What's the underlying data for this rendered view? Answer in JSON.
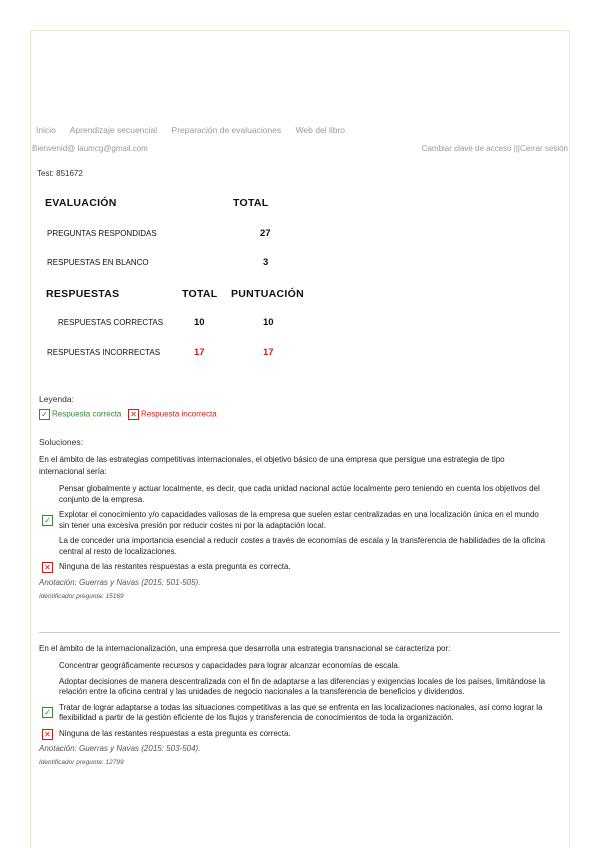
{
  "nav": {
    "items": [
      "Inicio",
      "Aprendizaje secuencial",
      "Preparación de evaluaciones",
      "Web del libro"
    ]
  },
  "header": {
    "welcome": "Bienvenid@ laumcg@gmail.com",
    "change_password": "Cambiar clave de acceso",
    "separator": "|||",
    "logout": "Cerrar sesión"
  },
  "test": {
    "label": "Test: 851672"
  },
  "results": {
    "evaluacion_heading": "EVALUACIÓN",
    "total_heading": "TOTAL",
    "answered_label": "PREGUNTAS RESPONDIDAS",
    "answered_value": "27",
    "blank_label": "RESPUESTAS EN BLANCO",
    "blank_value": "3",
    "respuestas_heading": "RESPUESTAS",
    "total_col": "TOTAL",
    "score_col": "PUNTUACIÓN",
    "correct_label": "RESPUESTAS CORRECTAS",
    "correct_total": "10",
    "correct_score": "10",
    "incorrect_label": "RESPUESTAS INCORRECTAS",
    "incorrect_total": "17",
    "incorrect_score": "17"
  },
  "legend": {
    "title": "Leyenda:",
    "correct": "Respuesta correcta",
    "incorrect": "Respuesta incorrecta"
  },
  "solutions": {
    "title": "Soluciones:",
    "questions": [
      {
        "stem": "En el ámbito de las estrategias competitivas internacionales, el objetivo básico de una empresa que persigue una estrategia de tipo internacional sería:",
        "options": [
          "Pensar globalmente y actuar localmente, es decir, que cada unidad nacional actúe localmente pero teniendo en cuenta los objetivos del conjunto de la empresa.",
          "Explotar el conocimiento y/o capacidades valiosas de la empresa que suelen estar centralizadas en una localización única en el mundo sin tener una excesiva presión por reducir costes ni por la adaptación local.",
          "La de conceder una importancia esencial a reducir costes a través de economías de escala y la transferencia de habilidades de la oficina central al resto de localizaciones.",
          "Ninguna de las restantes respuestas a esta pregunta es correcta."
        ],
        "annotation": "Anotación: Guerras y Navas (2015: 501-505).",
        "question_id": "Identificador pregunta: 15169"
      },
      {
        "stem": "En el ámbito de la internacionalización, una empresa que desarrolla una estrategia transnacional se caracteriza por:",
        "options": [
          "Concentrar geográficamente recursos y capacidades para lograr alcanzar economías de escala.",
          "Adoptar decisiones de manera descentralizada con el fin de adaptarse a las diferencias y exigencias locales de los países, limitándose la relación entre la oficina central y las unidades de negocio nacionales a la transferencia de beneficios y dividendos.",
          "Tratar de lograr adaptarse a todas las situaciones competitivas a las que se enfrenta en las localizaciones nacionales, así como lograr la flexibilidad a partir de la gestión eficiente de los flujos y transferencia de conocimientos de toda la organización.",
          "Ninguna de las restantes respuestas a esta pregunta es correcta."
        ],
        "annotation": "Anotación: Guerras y Navas (2015: 503-504).",
        "question_id": "Identificador pregunta: 12799"
      }
    ]
  },
  "icons": {
    "correct": "checkbox-check-icon",
    "incorrect": "checkbox-x-icon"
  },
  "colors": {
    "correct": "#2e8b2e",
    "incorrect": "#d11a1a",
    "muted": "#999999"
  }
}
